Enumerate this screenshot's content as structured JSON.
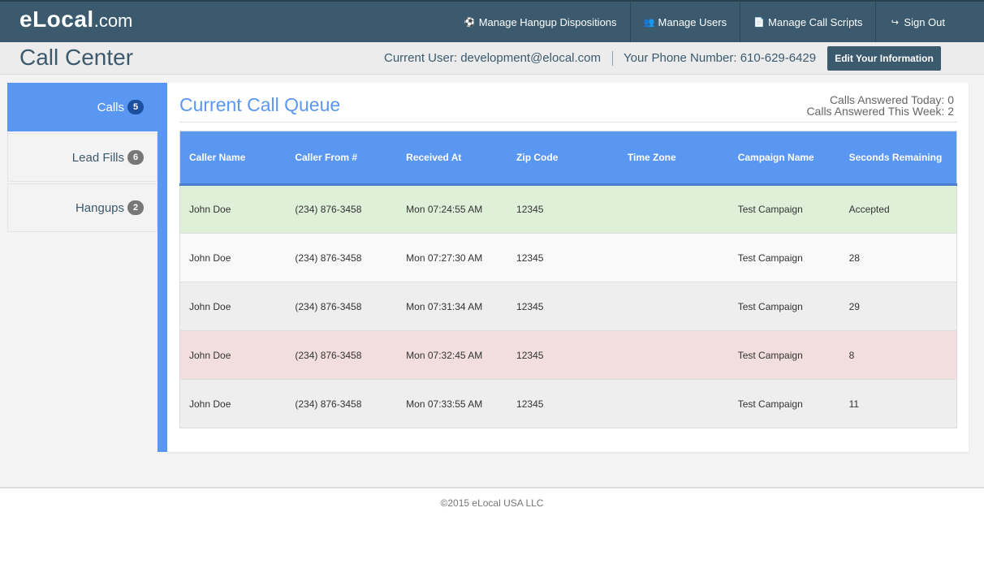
{
  "brand": {
    "name": "eLocal",
    "tld": ".com"
  },
  "nav": {
    "items": [
      {
        "label": "Manage Hangup Dispositions",
        "icon": "soccer-ball-icon",
        "glyph": "⚽"
      },
      {
        "label": "Manage Users",
        "icon": "users-icon",
        "glyph": "👥"
      },
      {
        "label": "Manage Call Scripts",
        "icon": "document-icon",
        "glyph": "📄"
      },
      {
        "label": "Sign Out",
        "icon": "sign-out-icon",
        "glyph": "↪"
      }
    ]
  },
  "header": {
    "title": "Call Center",
    "current_user": "Current User: development@elocal.com",
    "phone": "Your Phone Number: 610-629-6429",
    "edit_button": "Edit Your Information"
  },
  "sidebar": {
    "items": [
      {
        "label": "Calls",
        "count": "5",
        "active": true
      },
      {
        "label": "Lead Fills",
        "count": "6",
        "active": false
      },
      {
        "label": "Hangups",
        "count": "2",
        "active": false
      }
    ]
  },
  "queue": {
    "title": "Current Call Queue",
    "answered_today": "Calls Answered Today: 0",
    "answered_week": "Calls Answered This Week: 2"
  },
  "table": {
    "columns": [
      "Caller Name",
      "Caller From #",
      "Received At",
      "Zip Code",
      "Time Zone",
      "Campaign Name",
      "Seconds Remaining"
    ],
    "rows": [
      {
        "status": "accepted",
        "cells": [
          "John Doe",
          "(234) 876-3458",
          "Mon 07:24:55 AM",
          "12345",
          "",
          "Test Campaign",
          "Accepted"
        ]
      },
      {
        "status": "normal",
        "cells": [
          "John Doe",
          "(234) 876-3458",
          "Mon 07:27:30 AM",
          "12345",
          "",
          "Test Campaign",
          "28"
        ]
      },
      {
        "status": "alt",
        "cells": [
          "John Doe",
          "(234) 876-3458",
          "Mon 07:31:34 AM",
          "12345",
          "",
          "Test Campaign",
          "29"
        ]
      },
      {
        "status": "warn",
        "cells": [
          "John Doe",
          "(234) 876-3458",
          "Mon 07:32:45 AM",
          "12345",
          "",
          "Test Campaign",
          "8"
        ]
      },
      {
        "status": "alt",
        "cells": [
          "John Doe",
          "(234) 876-3458",
          "Mon 07:33:55 AM",
          "12345",
          "",
          "Test Campaign",
          "11"
        ]
      }
    ]
  },
  "footer": {
    "text": "©2015 eLocal USA LLC"
  },
  "colors": {
    "navbar": "#3b5a6e",
    "accent": "#5a97f2",
    "row_accepted": "#def0d8",
    "row_warning": "#f2dede"
  }
}
